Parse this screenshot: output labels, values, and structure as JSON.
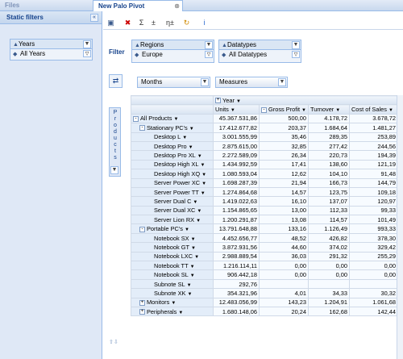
{
  "tabs": [
    {
      "label": "Files"
    },
    {
      "label": "New Palo Pivot"
    }
  ],
  "left_panel": {
    "title": "Static filters",
    "filter": {
      "dimension": "Years",
      "value": "All Years"
    }
  },
  "toolbar": {
    "icons": [
      "save-icon",
      "no-filter-icon",
      "sum-icon",
      "subtotal-icon",
      "eta-icon",
      "refresh-icon",
      "info-icon"
    ]
  },
  "filter_row": {
    "label": "Filter",
    "filters": [
      {
        "dimension": "Regions",
        "value": "Europe"
      },
      {
        "dimension": "Datatypes",
        "value": "All Datatypes"
      }
    ]
  },
  "pivot": {
    "col_dims": [
      "Months",
      "Measures"
    ],
    "row_dim": "Products",
    "column_header": "Year",
    "measures": [
      "Units",
      "Gross Profit",
      "Turnover",
      "Cost of Sales"
    ],
    "rows": [
      {
        "label": "All Products",
        "level": 0,
        "toggle": "-",
        "v": [
          "45.367.531,86",
          "500,00",
          "4.178,72",
          "3.678,72"
        ]
      },
      {
        "label": "Stationary PC's",
        "level": 1,
        "toggle": "-",
        "v": [
          "17.412.677,82",
          "203,37",
          "1.684,64",
          "1.481,27"
        ]
      },
      {
        "label": "Desktop L",
        "level": 2,
        "v": [
          "3.001.555,99",
          "35,46",
          "289,35",
          "253,89"
        ]
      },
      {
        "label": "Desktop Pro",
        "level": 2,
        "v": [
          "2.875.615,00",
          "32,85",
          "277,42",
          "244,56"
        ]
      },
      {
        "label": "Desktop Pro XL",
        "level": 2,
        "v": [
          "2.272.589,09",
          "26,34",
          "220,73",
          "194,39"
        ]
      },
      {
        "label": "Desktop High XL",
        "level": 2,
        "v": [
          "1.434.992,59",
          "17,41",
          "138,60",
          "121,19"
        ]
      },
      {
        "label": "Desktop High XQ",
        "level": 2,
        "v": [
          "1.080.593,04",
          "12,62",
          "104,10",
          "91,48"
        ]
      },
      {
        "label": "Server Power XC",
        "level": 2,
        "v": [
          "1.698.287,39",
          "21,94",
          "166,73",
          "144,79"
        ]
      },
      {
        "label": "Server Power TT",
        "level": 2,
        "v": [
          "1.274.864,68",
          "14,57",
          "123,75",
          "109,18"
        ]
      },
      {
        "label": "Server Dual C",
        "level": 2,
        "v": [
          "1.419.022,63",
          "16,10",
          "137,07",
          "120,97"
        ]
      },
      {
        "label": "Server Dual XC",
        "level": 2,
        "v": [
          "1.154.865,65",
          "13,00",
          "112,33",
          "99,33"
        ]
      },
      {
        "label": "Server Lion RX",
        "level": 2,
        "v": [
          "1.200.291,87",
          "13,08",
          "114,57",
          "101,49"
        ]
      },
      {
        "label": "Portable PC's",
        "level": 1,
        "toggle": "-",
        "v": [
          "13.791.648,88",
          "133,16",
          "1.126,49",
          "993,33"
        ]
      },
      {
        "label": "Notebook SX",
        "level": 2,
        "v": [
          "4.452.656,77",
          "48,52",
          "426,82",
          "378,30"
        ]
      },
      {
        "label": "Notebook GT",
        "level": 2,
        "v": [
          "3.872.931,56",
          "44,60",
          "374,02",
          "329,42"
        ]
      },
      {
        "label": "Notebook LXC",
        "level": 2,
        "v": [
          "2.988.889,54",
          "36,03",
          "291,32",
          "255,29"
        ]
      },
      {
        "label": "Notebook TT",
        "level": 2,
        "v": [
          "1.216.114,11",
          "0,00",
          "0,00",
          "0,00"
        ]
      },
      {
        "label": "Notebook SL",
        "level": 2,
        "v": [
          "906.442,18",
          "0,00",
          "0,00",
          "0,00"
        ]
      },
      {
        "label": "Subnote SL",
        "level": 2,
        "v": [
          "292,76",
          "",
          "",
          ""
        ]
      },
      {
        "label": "Subnote XK",
        "level": 2,
        "v": [
          "354.321,96",
          "4,01",
          "34,33",
          "30,32"
        ]
      },
      {
        "label": "Monitors",
        "level": 1,
        "toggle": "+",
        "v": [
          "12.483.056,99",
          "143,23",
          "1.204,91",
          "1.061,68"
        ]
      },
      {
        "label": "Peripherals",
        "level": 1,
        "toggle": "+",
        "v": [
          "1.680.148,06",
          "20,24",
          "162,68",
          "142,44"
        ]
      }
    ]
  }
}
